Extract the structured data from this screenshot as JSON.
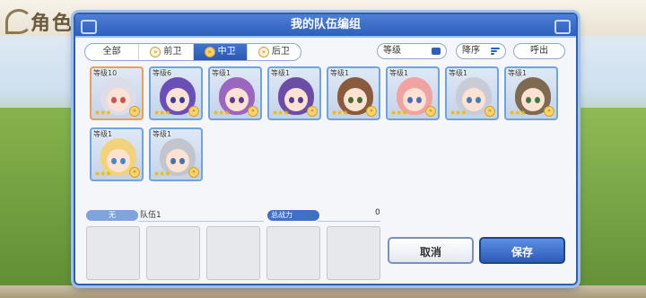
{
  "background": {
    "title": "角色"
  },
  "modal": {
    "title": "我的队伍编组",
    "filters": [
      {
        "label": "全部",
        "active": false
      },
      {
        "label": "前卫",
        "active": false
      },
      {
        "label": "中卫",
        "active": true
      },
      {
        "label": "后卫",
        "active": false
      }
    ],
    "sort": {
      "level_label": "等级",
      "order_label": "降序",
      "call_label": "呼出"
    },
    "characters": [
      {
        "level": "等级10",
        "stars": "★★★",
        "hair": "#dcdde8",
        "eye": "#c75454",
        "frame": "orange"
      },
      {
        "level": "等级6",
        "stars": "★★★",
        "hair": "#6a4fb9",
        "eye": "#3b3b9a",
        "frame": "blue"
      },
      {
        "level": "等级1",
        "stars": "★★★",
        "hair": "#9b66bf",
        "eye": "#5f3b8b",
        "frame": "blue"
      },
      {
        "level": "等级1",
        "stars": "★★★",
        "hair": "#6b4ca6",
        "eye": "#5a3b8d",
        "frame": "blue"
      },
      {
        "level": "等级1",
        "stars": "★★★",
        "hair": "#8a5a3c",
        "eye": "#4b6b2e",
        "frame": "blue"
      },
      {
        "level": "等级1",
        "stars": "★★★",
        "hair": "#f0a3a0",
        "eye": "#4d6cb8",
        "frame": "blue"
      },
      {
        "level": "等级1",
        "stars": "★★★",
        "hair": "#c9ccd6",
        "eye": "#4b7ab3",
        "frame": "blue"
      },
      {
        "level": "等级1",
        "stars": "★★★",
        "hair": "#7e6a4f",
        "eye": "#3b7a47",
        "frame": "blue"
      },
      {
        "level": "等级1",
        "stars": "★★★",
        "hair": "#f2d27a",
        "eye": "#4c86c9",
        "frame": "blue"
      },
      {
        "level": "等级1",
        "stars": "★★★",
        "hair": "#c2c4ce",
        "eye": "#4b6fa8",
        "frame": "blue"
      }
    ],
    "team": {
      "tag": "无",
      "name": "队伍1",
      "power_label": "总战力",
      "power_value": "0"
    },
    "buttons": {
      "cancel": "取消",
      "save": "保存"
    }
  }
}
